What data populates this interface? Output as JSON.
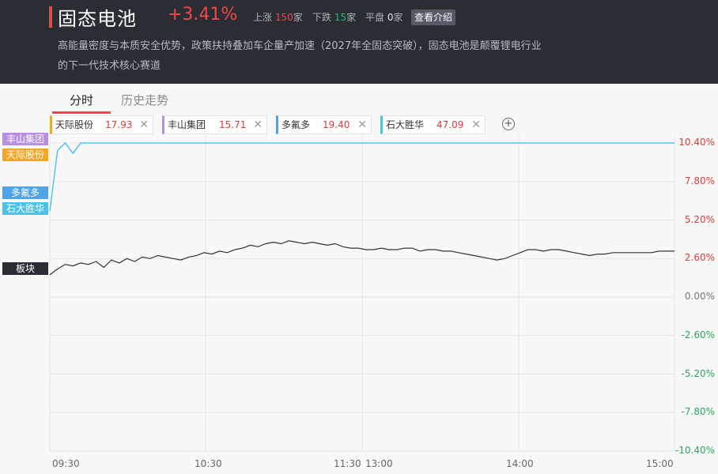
{
  "header": {
    "title": "固态电池",
    "change": "+3.41%",
    "up_label": "上涨",
    "up_count": "150",
    "unit": "家",
    "down_label": "下跌",
    "down_count": "15",
    "flat_label": "平盘",
    "flat_count": "0",
    "intro_button": "查看介绍",
    "description": "高能量密度与本质安全优势，政策扶持叠加车企量产加速（2027年全固态突破），固态电池是颠覆锂电行业的下一代技术核心赛道"
  },
  "tabs": [
    {
      "label": "分时",
      "active": true
    },
    {
      "label": "历史走势",
      "active": false
    }
  ],
  "chips": [
    {
      "name": "天际股份",
      "price": "17.93",
      "color": "#f5a623"
    },
    {
      "name": "丰山集团",
      "price": "15.71",
      "color": "#b88fe0"
    },
    {
      "name": "多氟多",
      "price": "19.40",
      "color": "#4fa3e8"
    },
    {
      "name": "石大胜华",
      "price": "47.09",
      "color": "#4bc2e8"
    }
  ],
  "close_icon": "close-icon",
  "add_icon": "plus-circle-icon",
  "tags": {
    "fengshan": "丰山集团",
    "tianji": "天际股份",
    "duofuduo": "多氟多",
    "shida": "石大胜华",
    "bankuai": "板块"
  },
  "tag_colors": {
    "fengshan": "#b88fe0",
    "tianji": "#f5a623",
    "duofuduo": "#4fa3e8",
    "shida": "#4bc2e8",
    "bankuai": "#2b2d35"
  },
  "chart_data": {
    "type": "line",
    "x_ticks": [
      "09:30",
      "10:30",
      "11:30",
      "13:00",
      "14:00",
      "15:00"
    ],
    "y_ticks": [
      "10.40%",
      "7.80%",
      "5.20%",
      "2.60%",
      "0.00%",
      "-2.60%",
      "-5.20%",
      "-7.80%",
      "-10.40%"
    ],
    "ylim": [
      -10.4,
      10.4
    ],
    "y_tick_values": [
      10.4,
      7.8,
      5.2,
      2.6,
      0.0,
      -2.6,
      -5.2,
      -7.8,
      -10.4
    ],
    "series": [
      {
        "name": "板块",
        "color": "#333333",
        "values": [
          1.5,
          1.9,
          2.2,
          2.1,
          2.3,
          2.2,
          2.4,
          2.0,
          2.5,
          2.3,
          2.6,
          2.4,
          2.7,
          2.6,
          2.8,
          2.7,
          2.6,
          2.5,
          2.7,
          2.8,
          3.0,
          2.9,
          3.1,
          3.0,
          3.2,
          3.3,
          3.5,
          3.4,
          3.6,
          3.7,
          3.6,
          3.8,
          3.7,
          3.6,
          3.7,
          3.6,
          3.5,
          3.6,
          3.4,
          3.3,
          3.3,
          3.2,
          3.2,
          3.3,
          3.2,
          3.2,
          3.3,
          3.3,
          3.1,
          3.2,
          3.2,
          3.1,
          3.1,
          3.0,
          2.9,
          2.8,
          2.7,
          2.6,
          2.5,
          2.6,
          2.8,
          3.0,
          3.2,
          3.2,
          3.1,
          3.2,
          3.2,
          3.1,
          3.0,
          2.9,
          2.8,
          2.9,
          2.9,
          3.0,
          3.0,
          3.0,
          3.0,
          3.0,
          3.0,
          3.1,
          3.1,
          3.1
        ]
      },
      {
        "name": "丰山集团",
        "color": "#4fc3f7",
        "values": [
          5.8,
          9.9,
          10.4,
          9.7,
          10.4,
          10.4,
          10.4,
          10.4,
          10.4,
          10.4,
          10.4,
          10.4,
          10.4,
          10.4,
          10.4,
          10.4,
          10.4,
          10.4,
          10.4,
          10.4,
          10.4,
          10.4,
          10.4,
          10.4,
          10.4,
          10.4,
          10.4,
          10.4,
          10.4,
          10.4,
          10.4,
          10.4,
          10.4,
          10.4,
          10.4,
          10.4,
          10.4,
          10.4,
          10.4,
          10.4,
          10.4,
          10.4,
          10.4,
          10.4,
          10.4,
          10.4,
          10.4,
          10.4,
          10.4,
          10.4,
          10.4,
          10.4,
          10.4,
          10.4,
          10.4,
          10.4,
          10.4,
          10.4,
          10.4,
          10.4,
          10.4,
          10.4,
          10.4,
          10.4,
          10.4,
          10.4,
          10.4,
          10.4,
          10.4,
          10.4,
          10.4,
          10.4,
          10.4,
          10.4,
          10.4,
          10.4,
          10.4,
          10.4,
          10.4,
          10.4,
          10.4,
          10.4
        ]
      }
    ]
  }
}
